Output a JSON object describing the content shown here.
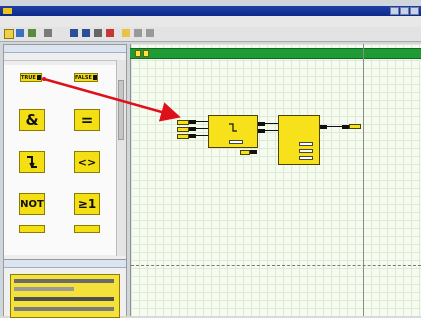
{
  "window": {
    "title": ""
  },
  "left_panel": {
    "header": "",
    "subheader": "",
    "tiles": [
      {
        "text": "TRUE",
        "caption": ""
      },
      {
        "text": "FALSE",
        "caption": ""
      },
      {
        "text": "&",
        "caption": ""
      },
      {
        "text": "=",
        "caption": ""
      },
      {
        "text": "",
        "caption": ""
      },
      {
        "text": "<>",
        "caption": ""
      },
      {
        "text": "NOT",
        "caption": ""
      },
      {
        "text": "≥1",
        "caption": ""
      }
    ],
    "section_label": ""
  },
  "lower_panel": {
    "header": ""
  },
  "canvas": {
    "banner_text": ""
  },
  "colors": {
    "accent": "#1e9b34",
    "block": "#f7e11a",
    "arrow": "#e0101b"
  }
}
